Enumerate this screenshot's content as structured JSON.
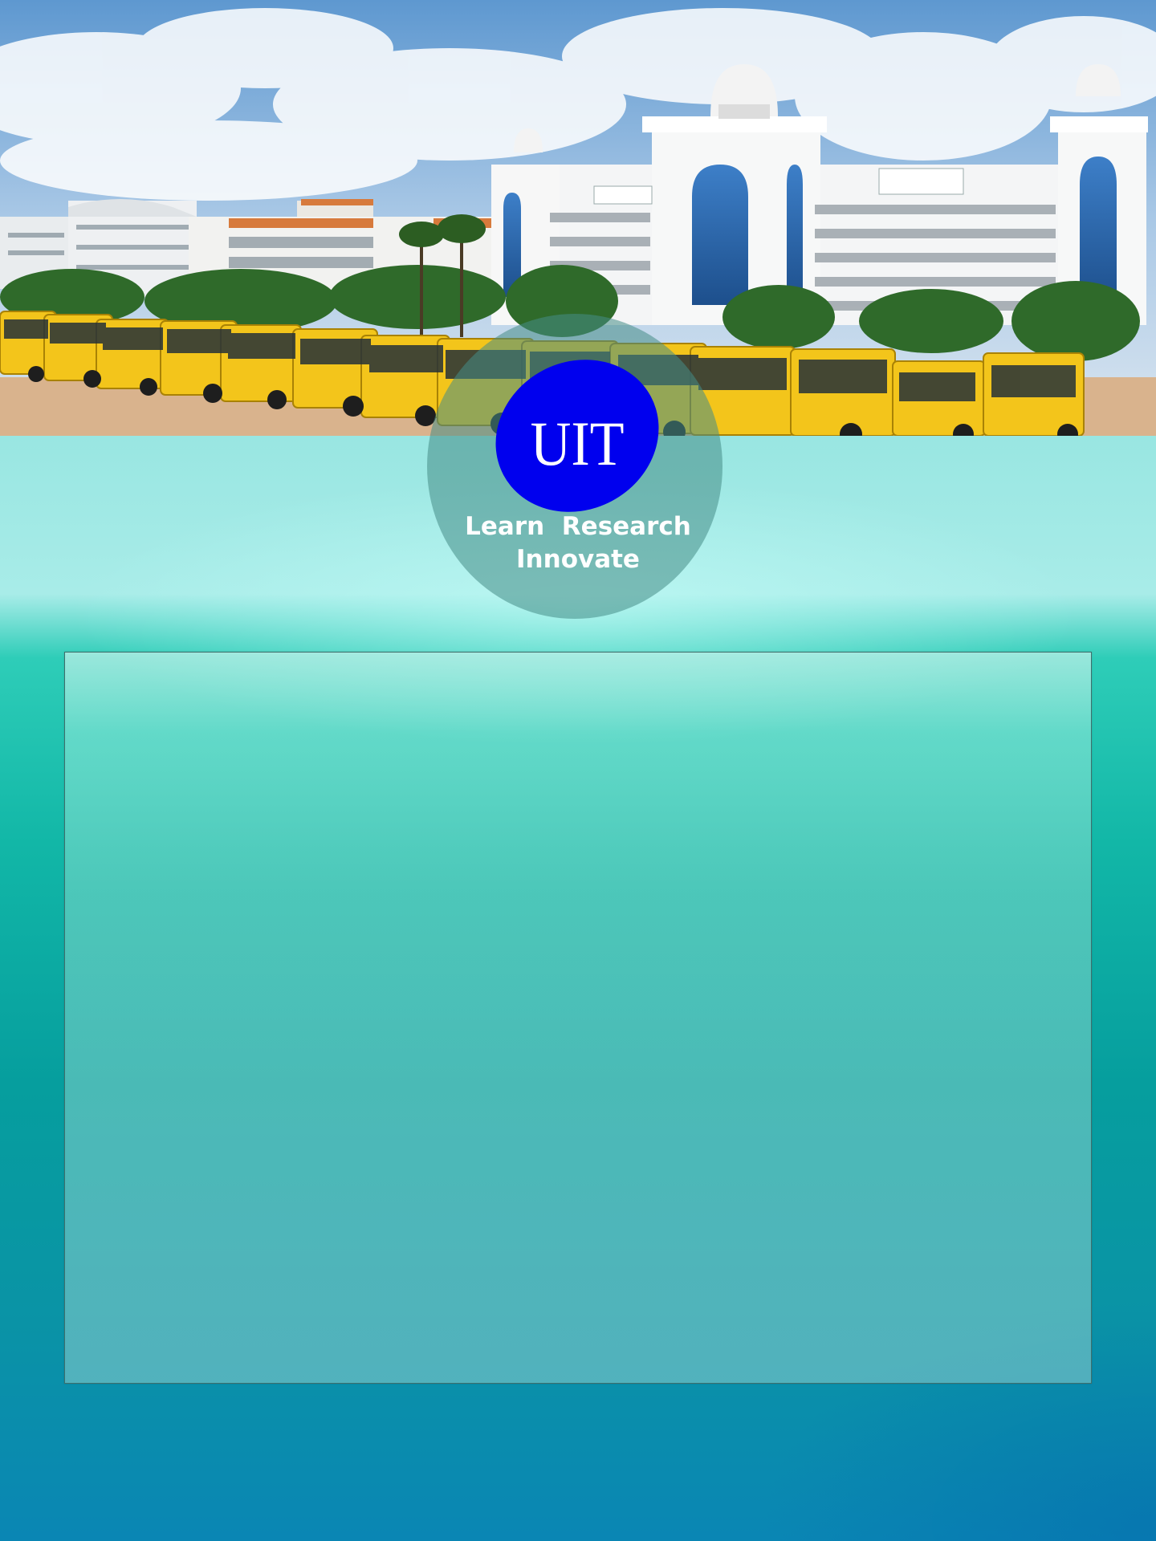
{
  "hero": {
    "image_name": "campus-building-and-buses-photo",
    "colors": {
      "sky": "#7fb0dc",
      "building": "#f1f3f4",
      "glass": "#2b6fb8",
      "bus": "#f3c51b",
      "trees": "#2f6a2a",
      "ground": "#d9b38d"
    }
  },
  "logo": {
    "letters": "UIT",
    "tagline_line1": "Learn  Research",
    "tagline_line2": "Innovate",
    "colors": {
      "oval": "#0000ee",
      "letters": "#ffffff",
      "badge": "#468c87"
    }
  },
  "content_panel": {
    "colors": {
      "border": "#3f6f6c"
    }
  },
  "background": {
    "colors": {
      "top": "#a8ece8",
      "bottom": "#0a86b4"
    }
  }
}
